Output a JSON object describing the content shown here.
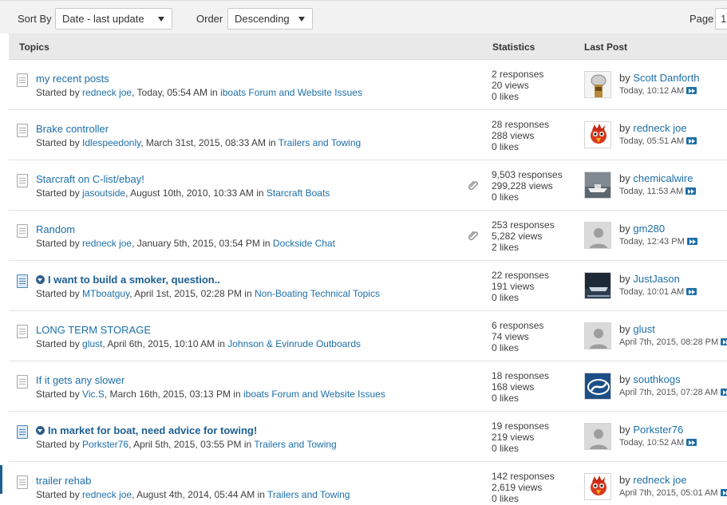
{
  "toolbar": {
    "sort_label": "Sort By",
    "sort_value": "Date - last update",
    "order_label": "Order",
    "order_value": "Descending",
    "page_label": "Page",
    "page_value": "1"
  },
  "columns": {
    "topics": "Topics",
    "statistics": "Statistics",
    "last_post": "Last Post"
  },
  "topics": [
    {
      "title": "my recent posts",
      "started_by": "Started by",
      "author": "redneck joe",
      "date": "Today, 05:54 AM",
      "in": "in",
      "forum": "iboats Forum and Website Issues",
      "responses": "2 responses",
      "views": "20 views",
      "likes": "0 likes",
      "by": "by",
      "last_user": "Scott Danforth",
      "last_time": "Today, 10:12 AM",
      "unread": false,
      "attachment": false,
      "avatar": "bottle-avatar"
    },
    {
      "title": "Brake controller",
      "started_by": "Started by",
      "author": "Idlespeedonly",
      "date": "March 31st, 2015, 08:33 AM",
      "in": "in",
      "forum": "Trailers and Towing",
      "responses": "28 responses",
      "views": "288 views",
      "likes": "0 likes",
      "by": "by",
      "last_user": "redneck joe",
      "last_time": "Today, 05:51 AM",
      "unread": false,
      "attachment": false,
      "avatar": "rooster-avatar"
    },
    {
      "title": "Starcraft on C-list/ebay!",
      "started_by": "Started by",
      "author": "jasoutside",
      "date": "August 10th, 2010, 10:33 AM",
      "in": "in",
      "forum": "Starcraft Boats",
      "responses": "9,503 responses",
      "views": "299,228 views",
      "likes": "0 likes",
      "by": "by",
      "last_user": "chemicalwire",
      "last_time": "Today, 11:53 AM",
      "unread": false,
      "attachment": true,
      "avatar": "boat-avatar"
    },
    {
      "title": "Random",
      "started_by": "Started by",
      "author": "redneck joe",
      "date": "January 5th, 2015, 03:54 PM",
      "in": "in",
      "forum": "Dockside Chat",
      "responses": "253 responses",
      "views": "5,282 views",
      "likes": "2 likes",
      "by": "by",
      "last_user": "gm280",
      "last_time": "Today, 12:43 PM",
      "unread": false,
      "attachment": true,
      "avatar": "default-avatar"
    },
    {
      "title": "I want to build a smoker, question..",
      "started_by": "Started by",
      "author": "MTboatguy",
      "date": "April 1st, 2015, 02:28 PM",
      "in": "in",
      "forum": "Non-Boating Technical Topics",
      "responses": "22 responses",
      "views": "191 views",
      "likes": "0 likes",
      "by": "by",
      "last_user": "JustJason",
      "last_time": "Today, 10:01 AM",
      "unread": true,
      "attachment": false,
      "avatar": "dark-boat-avatar"
    },
    {
      "title": "LONG TERM STORAGE",
      "started_by": "Started by",
      "author": "glust",
      "date": "April 6th, 2015, 10:10 AM",
      "in": "in",
      "forum": "Johnson & Evinrude Outboards",
      "responses": "6 responses",
      "views": "74 views",
      "likes": "0 likes",
      "by": "by",
      "last_user": "glust",
      "last_time": "April 7th, 2015, 08:28 PM",
      "unread": false,
      "attachment": false,
      "avatar": "default-avatar"
    },
    {
      "title": "If it gets any slower",
      "started_by": "Started by",
      "author": "Vic.S",
      "date": "March 16th, 2015, 03:13 PM",
      "in": "in",
      "forum": "iboats Forum and Website Issues",
      "responses": "18 responses",
      "views": "168 views",
      "likes": "0 likes",
      "by": "by",
      "last_user": "southkogs",
      "last_time": "April 7th, 2015, 07:28 AM",
      "unread": false,
      "attachment": false,
      "avatar": "logo-avatar"
    },
    {
      "title": "In market for boat, need advice for towing!",
      "started_by": "Started by",
      "author": "Porkster76",
      "date": "April 5th, 2015, 03:55 PM",
      "in": "in",
      "forum": "Trailers and Towing",
      "responses": "19 responses",
      "views": "219 views",
      "likes": "0 likes",
      "by": "by",
      "last_user": "Porkster76",
      "last_time": "Today, 10:52 AM",
      "unread": true,
      "attachment": false,
      "avatar": "default-avatar"
    },
    {
      "title": "trailer rehab",
      "started_by": "Started by",
      "author": "redneck joe",
      "date": "August 4th, 2014, 05:44 AM",
      "in": "in",
      "forum": "Trailers and Towing",
      "responses": "142 responses",
      "views": "2,619 views",
      "likes": "0 likes",
      "by": "by",
      "last_user": "redneck joe",
      "last_time": "April 7th, 2015, 05:01 AM",
      "unread": false,
      "attachment": false,
      "avatar": "rooster-avatar"
    }
  ]
}
